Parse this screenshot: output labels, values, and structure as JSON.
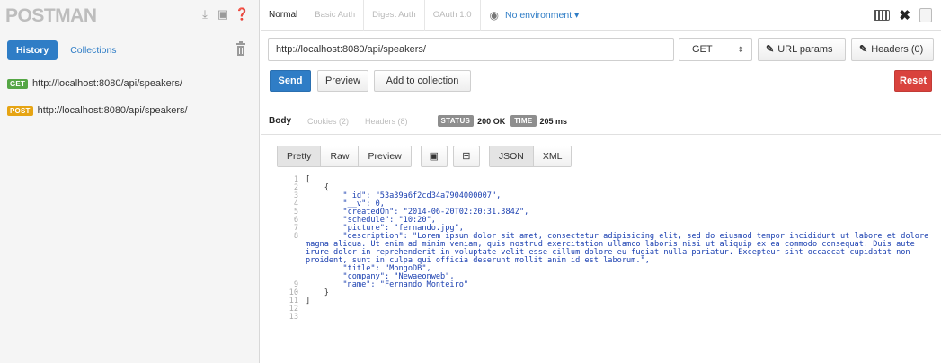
{
  "sidebar": {
    "brand": "POSTMAN",
    "tabs": [
      {
        "label": "History",
        "active": true
      },
      {
        "label": "Collections",
        "active": false
      }
    ],
    "history": [
      {
        "method": "GET",
        "url": "http://localhost:8080/api/speakers/"
      },
      {
        "method": "POST",
        "url": "http://localhost:8080/api/speakers/"
      }
    ]
  },
  "auth_tabs": [
    "Normal",
    "Basic Auth",
    "Digest Auth",
    "OAuth 1.0"
  ],
  "environment": "No environment",
  "request": {
    "url": "http://localhost:8080/api/speakers/",
    "method": "GET",
    "url_params_label": "URL params",
    "headers_label": "Headers (0)"
  },
  "actions": {
    "send": "Send",
    "preview": "Preview",
    "add": "Add to collection",
    "reset": "Reset"
  },
  "response": {
    "tabs": [
      "Body",
      "Cookies (2)",
      "Headers (8)"
    ],
    "status_label": "STATUS",
    "status_value": "200 OK",
    "time_label": "TIME",
    "time_value": "205 ms"
  },
  "view": {
    "modes": [
      "Pretty",
      "Raw",
      "Preview"
    ],
    "formats": [
      "JSON",
      "XML"
    ]
  },
  "code": {
    "line_numbers": [
      "1",
      "2",
      "3",
      "4",
      "5",
      "6",
      "7",
      "8",
      "9",
      "10",
      "11",
      "12",
      "13"
    ],
    "lines": [
      "[",
      "    {",
      "        \"_id\": \"53a39a6f2cd34a7904000007\",",
      "        \"__v\": 0,",
      "        \"createdOn\": \"2014-06-20T02:20:31.384Z\",",
      "        \"schedule\": \"10:20\",",
      "        \"picture\": \"fernando.jpg\",",
      "        \"description\": \"Lorem ipsum dolor sit amet, consectetur adipisicing elit, sed do eiusmod tempor incididunt ut labore et dolore magna aliqua. Ut enim ad minim veniam, quis nostrud exercitation ullamco laboris nisi ut aliquip ex ea commodo consequat. Duis aute irure dolor in reprehenderit in voluptate velit esse cillum dolore eu fugiat nulla pariatur. Excepteur sint occaecat cupidatat non proident, sunt in culpa qui officia deserunt mollit anim id est laborum.\",",
      "        \"title\": \"MongoDB\",",
      "        \"company\": \"Newaeonweb\",",
      "        \"name\": \"Fernando Monteiro\"",
      "    }",
      "]"
    ]
  }
}
